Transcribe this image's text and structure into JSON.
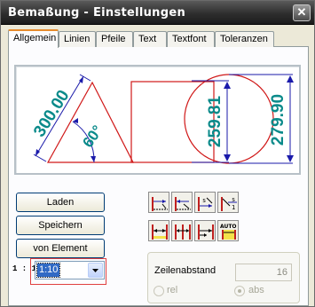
{
  "window": {
    "title": "Bemaßung - Einstellungen",
    "close_label": "✕"
  },
  "tabs": [
    {
      "label": "Allgemein",
      "active": true
    },
    {
      "label": "Linien",
      "active": false
    },
    {
      "label": "Pfeile",
      "active": false
    },
    {
      "label": "Text",
      "active": false
    },
    {
      "label": "Textfont",
      "active": false
    },
    {
      "label": "Toleranzen",
      "active": false
    }
  ],
  "preview": {
    "dimension_texts": [
      "300.00",
      "60°",
      "259.81",
      "279.90"
    ],
    "colors": {
      "geometry": "#d01818",
      "dimension": "#0a8a8a",
      "arrows": "#1a1aaa"
    }
  },
  "buttons": {
    "load": "Laden",
    "save": "Speichern",
    "from_element": "von Element"
  },
  "icon_buttons": [
    "dimension-horizontal-icon",
    "dimension-vertical-icon",
    "dimension-tolerance-icon",
    "dimension-arrow-text-icon",
    "dimension-chain-icon",
    "dimension-chain-alt-icon",
    "dimension-baseline-icon",
    "dimension-auto-icon"
  ],
  "auto_label": "AUTO",
  "scale": {
    "label": "1 : 1",
    "value": "1:10"
  },
  "line_spacing": {
    "label": "Zeilenabstand",
    "value": "16",
    "options": [
      "rel",
      "abs"
    ],
    "selected": "abs"
  }
}
